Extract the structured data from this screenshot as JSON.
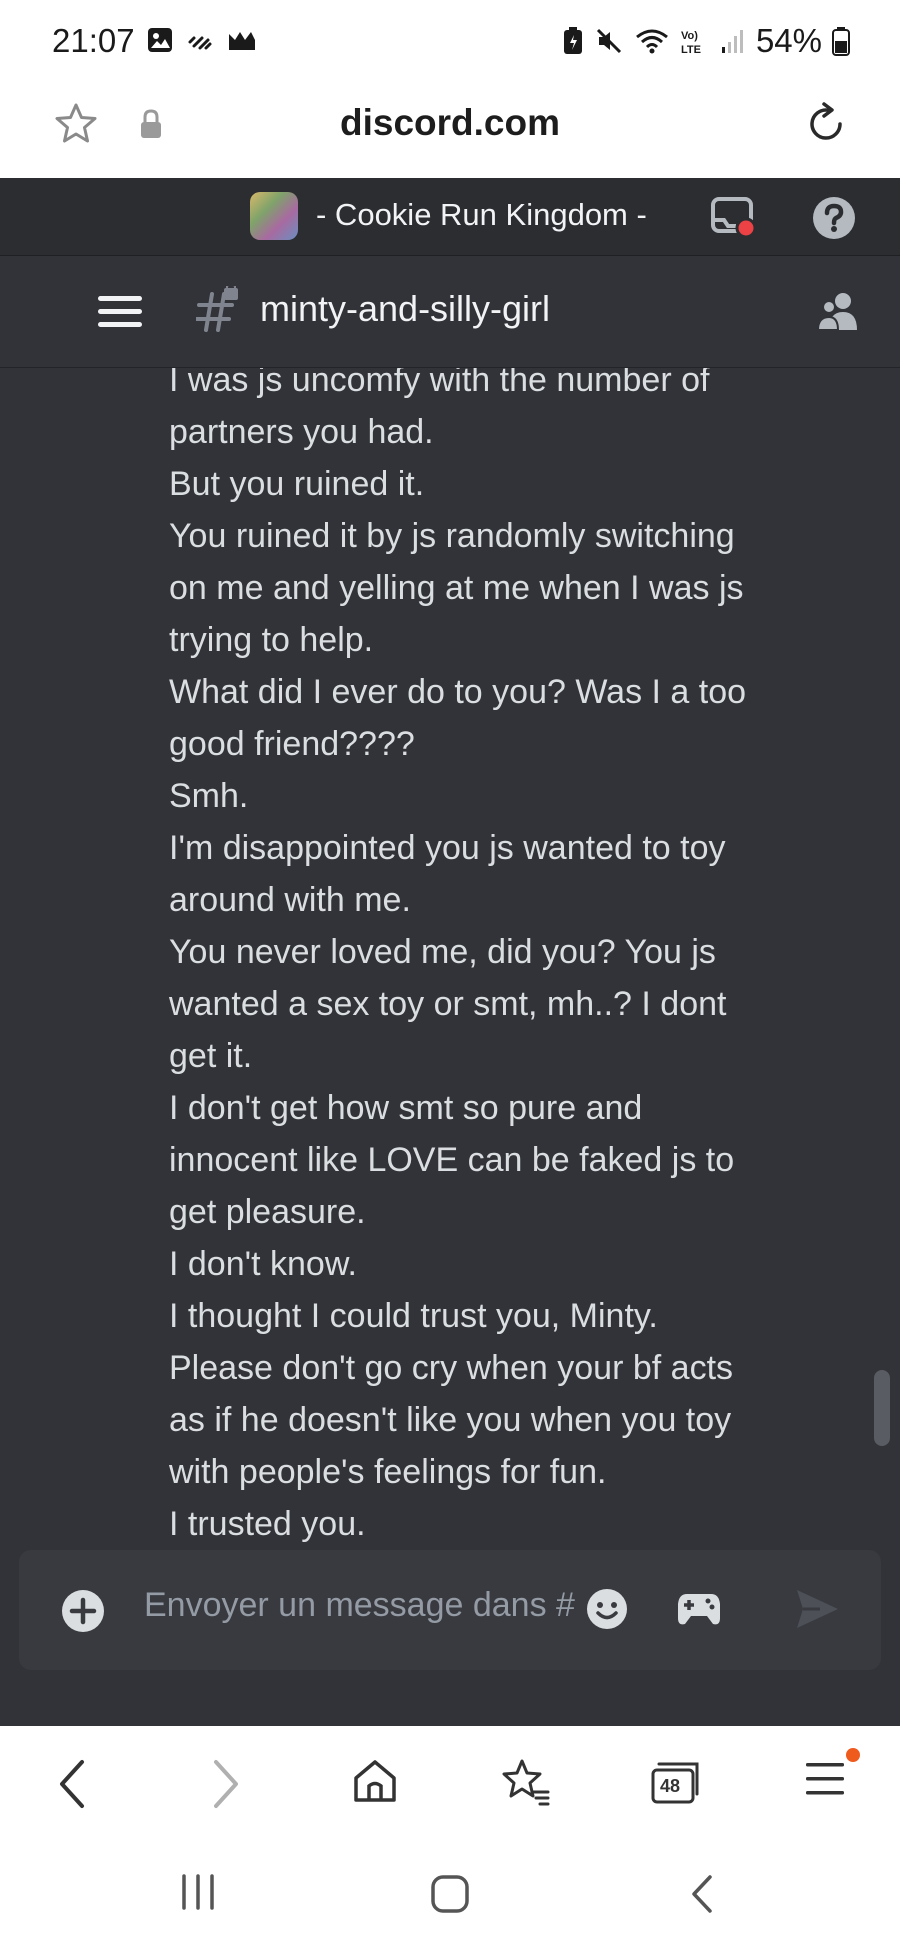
{
  "status_bar": {
    "time": "21:07",
    "battery": "54%",
    "icons": [
      "image-icon",
      "signal-slash-icon",
      "cat-icon",
      "battery-saver-icon",
      "mute-icon",
      "wifi-icon",
      "volte-icon",
      "signal-icon",
      "battery-icon"
    ]
  },
  "browser": {
    "url": "discord.com",
    "tab_count": "48"
  },
  "server": {
    "name": "- Cookie Run Kingdom -"
  },
  "channel": {
    "name": "minty-and-silly-girl"
  },
  "messages": {
    "lines": [
      "I was js uncomfy with the number of",
      "partners you had.",
      "But you ruined it.",
      "You ruined it by js randomly switching",
      "on me and yelling at me when I was js",
      "trying to help.",
      "What did I ever do to you? Was I a too",
      "good friend????",
      "Smh.",
      "I'm disappointed you js wanted to toy",
      "around with me.",
      "You never loved me, did you? You js",
      "wanted a sex toy or smt, mh..? I dont",
      "get it.",
      "I don't get how smt so pure and",
      "innocent like LOVE can be faked js to",
      "get pleasure.",
      "I don't know.",
      "I thought I could trust you, Minty.",
      "Please don't go cry when your bf acts",
      "as if he doesn't like you when you toy",
      "with people's feelings for fun.",
      "I trusted you."
    ]
  },
  "composer": {
    "placeholder": "Envoyer un message dans #"
  },
  "colors": {
    "discord_bg": "#313338",
    "server_header_bg": "#2b2d31",
    "composer_bg": "#383a40",
    "message_text": "#dbdee1",
    "notification_red": "#ed4245",
    "browser_dot": "#ef5a1d"
  }
}
